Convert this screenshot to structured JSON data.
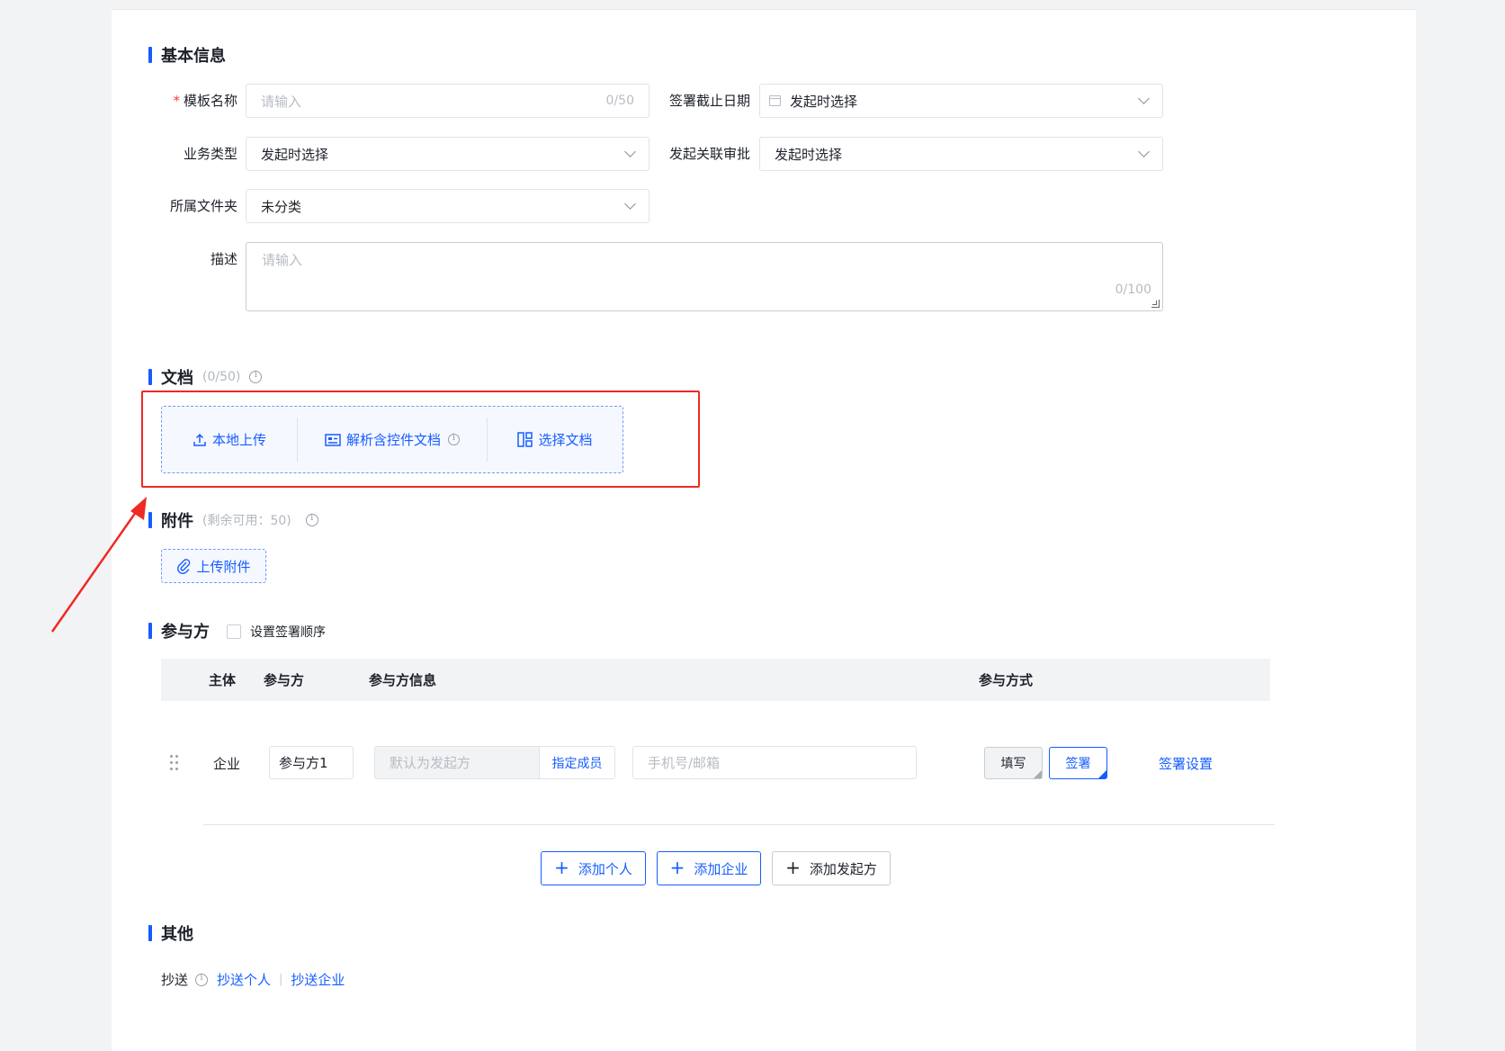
{
  "basic_info": {
    "section_title": "基本信息",
    "template_name": {
      "label": "模板名称",
      "required_mark": "*",
      "placeholder": "请输入",
      "counter": "0/50"
    },
    "sign_deadline": {
      "label": "签署截止日期",
      "value": "发起时选择"
    },
    "business_type": {
      "label": "业务类型",
      "value": "发起时选择"
    },
    "linked_approval": {
      "label": "发起关联审批",
      "value": "发起时选择"
    },
    "folder": {
      "label": "所属文件夹",
      "value": "未分类"
    },
    "description": {
      "label": "描述",
      "placeholder": "请输入",
      "counter": "0/100"
    }
  },
  "documents": {
    "section_title": "文档",
    "count": "(0/50)",
    "local_upload": "本地上传",
    "parse_control_doc": "解析含控件文档",
    "select_doc": "选择文档"
  },
  "attachments": {
    "section_title": "附件",
    "remaining": "(剩余可用：50)",
    "upload_button": "上传附件"
  },
  "participants": {
    "section_title": "参与方",
    "set_order_label": "设置签署顺序",
    "columns": {
      "subject": "主体",
      "party": "参与方",
      "party_info": "参与方信息",
      "method": "参与方式"
    },
    "rows": [
      {
        "subject": "企业",
        "party_name": "参与方1",
        "default_initiator_placeholder": "默认为发起方",
        "assign_member": "指定成员",
        "contact_placeholder": "手机号/邮箱",
        "fill_button": "填写",
        "sign_button": "签署",
        "sign_settings": "签署设置"
      }
    ],
    "add_person": "添加个人",
    "add_company": "添加企业",
    "add_initiator": "添加发起方"
  },
  "other": {
    "section_title": "其他",
    "cc_label": "抄送",
    "cc_person": "抄送个人",
    "cc_divider": "|",
    "cc_company": "抄送企业"
  },
  "colors": {
    "accent": "#165dff",
    "annotation_red": "#ee2a24",
    "required": "#f53f3f"
  }
}
